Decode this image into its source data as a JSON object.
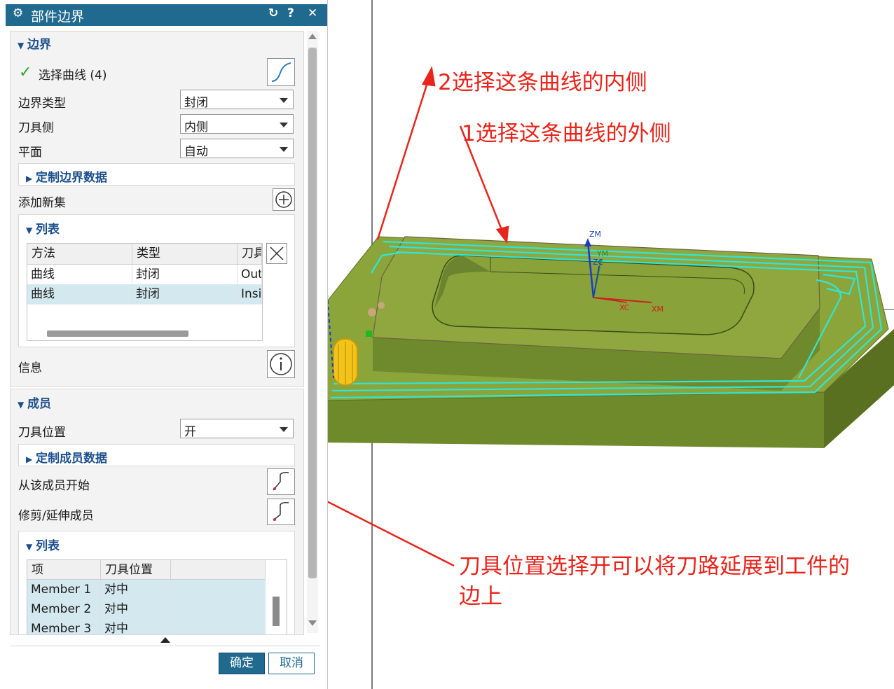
{
  "dialog": {
    "title": "部件边界",
    "title_icons": [
      "gear-icon",
      "reset-icon",
      "help-icon",
      "close-icon"
    ],
    "boundary_section": {
      "header": "边界",
      "select_curve_label": "选择曲线 (4)",
      "boundary_type_label": "边界类型",
      "boundary_type_value": "封闭",
      "tool_side_label": "刀具侧",
      "tool_side_value": "内侧",
      "plane_label": "平面",
      "plane_value": "自动",
      "custom_boundary_data": "定制边界数据",
      "add_new_set": "添加新集",
      "list_header": "列表",
      "list_columns": [
        "方法",
        "类型",
        "刀具"
      ],
      "list_rows": [
        {
          "method": "曲线",
          "type": "封闭",
          "tool": "Out"
        },
        {
          "method": "曲线",
          "type": "封闭",
          "tool": "Insi"
        }
      ],
      "info_label": "信息"
    },
    "members_section": {
      "header": "成员",
      "tool_position_label": "刀具位置",
      "tool_position_value": "开",
      "custom_member_data": "定制成员数据",
      "start_from_member": "从该成员开始",
      "trim_extend_member": "修剪/延伸成员",
      "list_header": "列表",
      "list_columns": [
        "项",
        "刀具位置"
      ],
      "list_rows": [
        {
          "item": "Member 1",
          "pos": "对中"
        },
        {
          "item": "Member 2",
          "pos": "对中"
        },
        {
          "item": "Member 3",
          "pos": "对中"
        }
      ]
    },
    "ok_button": "确定",
    "cancel_button": "取消"
  },
  "viewport": {
    "axis_labels": {
      "zm": "ZM",
      "ym": "YM",
      "zc": "ZC",
      "xc": "XC",
      "xm": "XM"
    },
    "colors": {
      "part_top": "#8ea63c",
      "part_side": "#6f8a2a",
      "toolpath": "#33e6d6",
      "annotation": "#e8241b"
    }
  },
  "annotations": {
    "a1": "1选择这条曲线的外侧",
    "a2": "2选择这条曲线的内侧",
    "a3_line1": "刀具位置选择开可以将刀路延展到工件的",
    "a3_line2": "边上"
  }
}
